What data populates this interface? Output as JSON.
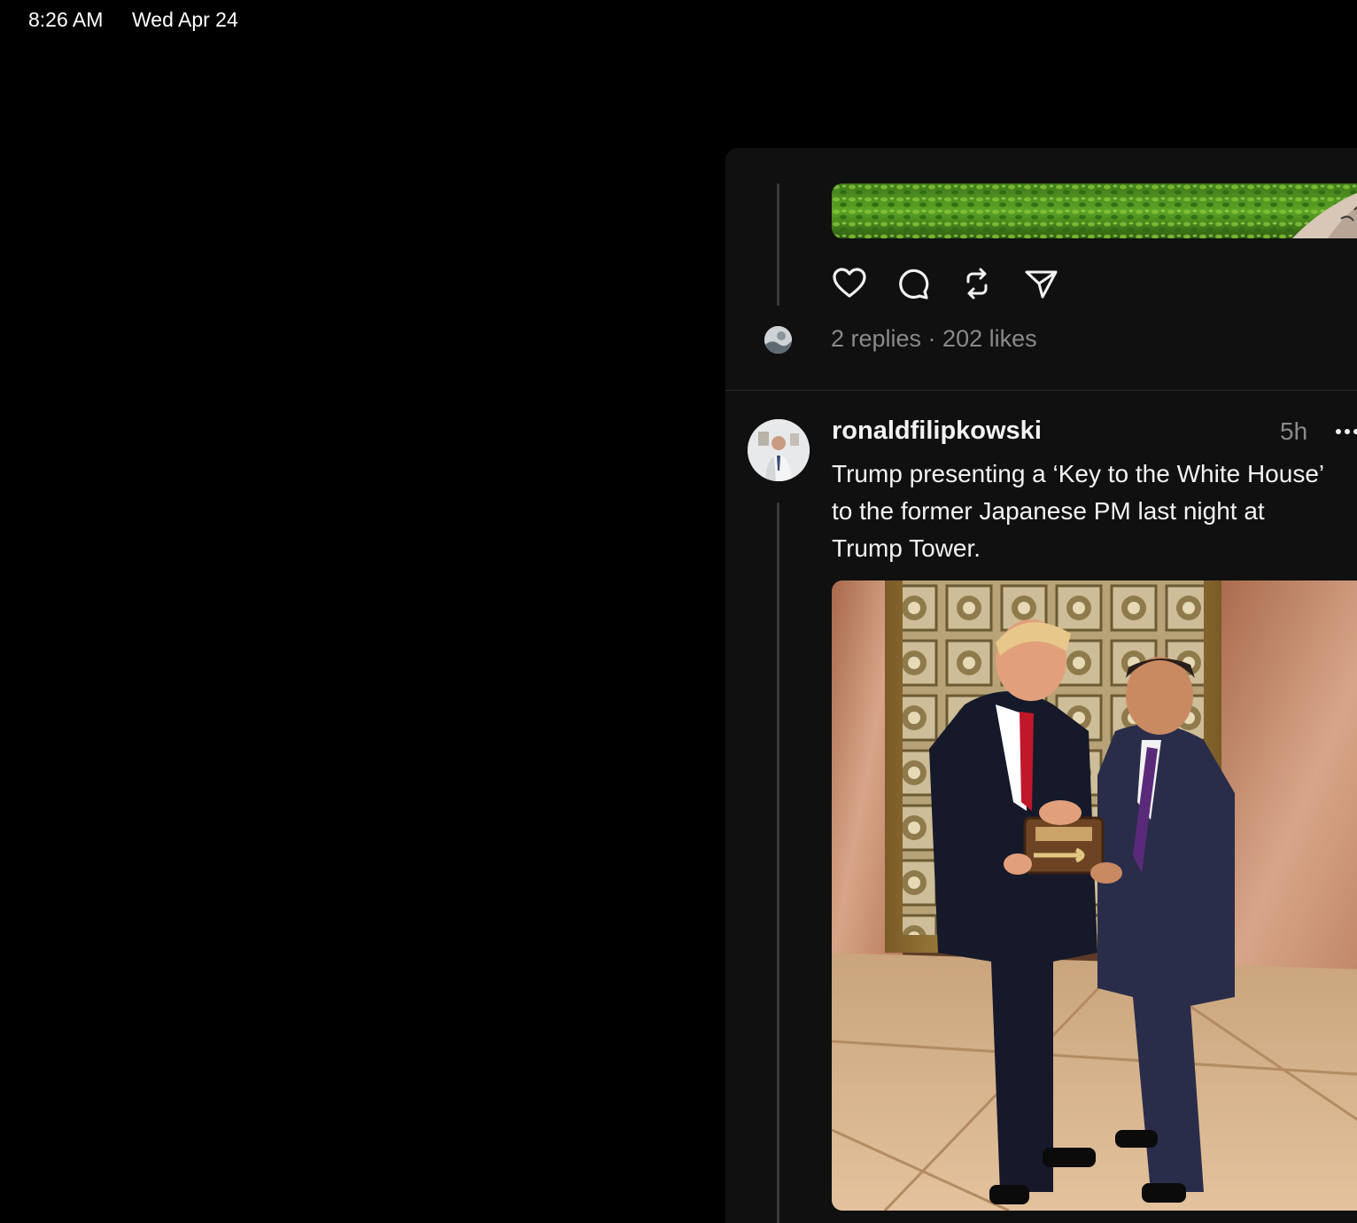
{
  "status_bar": {
    "time": "8:26 AM",
    "date": "Wed Apr 24"
  },
  "post1": {
    "actions": {
      "like_icon": "heart-icon",
      "reply_icon": "speech-bubble-icon",
      "repost_icon": "repost-icon",
      "share_icon": "send-icon"
    },
    "meta": "2 replies · 202 likes"
  },
  "post2": {
    "username": "ronaldfilipkowski",
    "timestamp": "5h",
    "more_icon": "more-icon",
    "text": "Trump presenting a ‘Key to the White House’ to the former Japanese PM last night at Trump Tower."
  },
  "colors": {
    "background": "#000000",
    "panel": "#101010",
    "text_primary": "#f3f3f3",
    "text_secondary": "#8a8a8a",
    "divider": "#2c2c2c"
  }
}
